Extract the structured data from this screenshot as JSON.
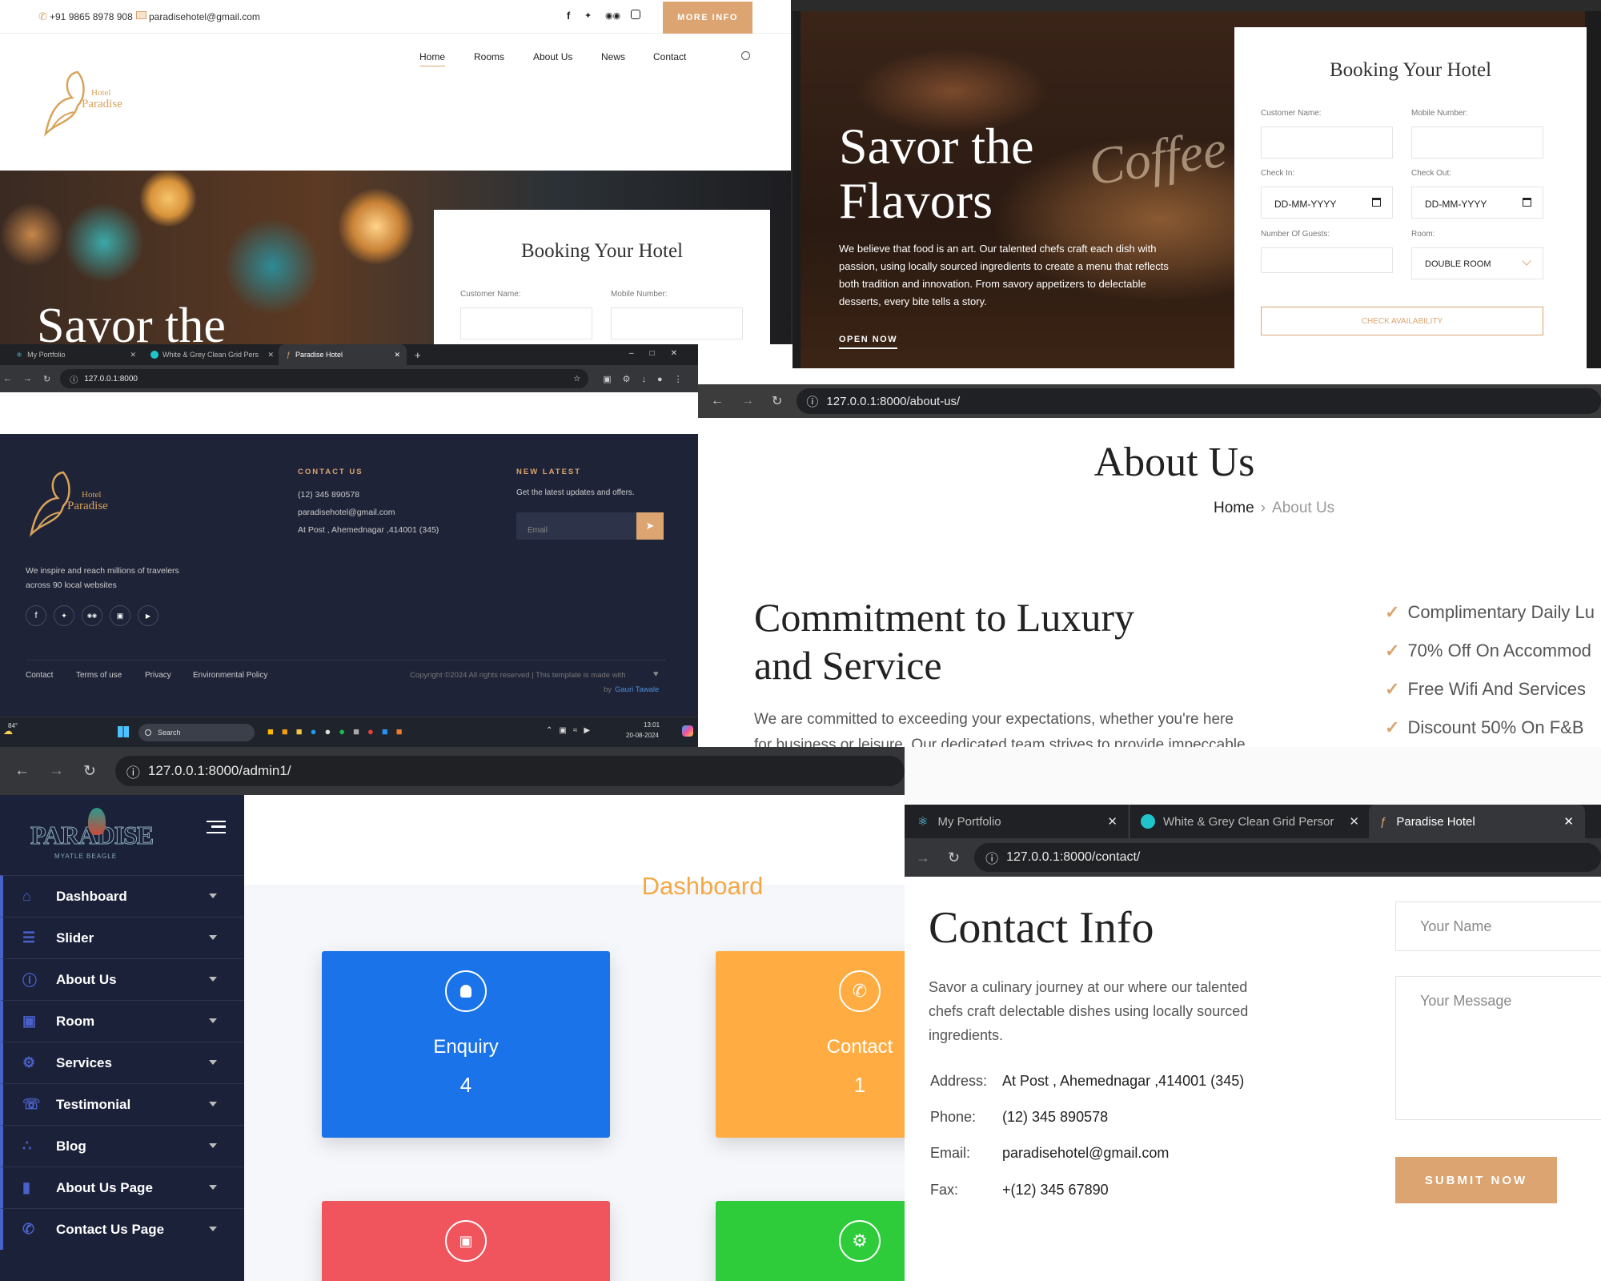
{
  "home": {
    "phone": "+91 9865 8978 908",
    "email": "paradisehotel@gmail.com",
    "more_info": "MORE INFO",
    "logo_top": "Hotel",
    "logo_main": "Paradise",
    "nav": [
      "Home",
      "Rooms",
      "About Us",
      "News",
      "Contact"
    ],
    "hero_partial": "Savor the",
    "booking_title": "Booking Your Hotel",
    "customer_label": "Customer Name:",
    "mobile_label": "Mobile Number:"
  },
  "hero": {
    "title_line1": "Savor the",
    "title_line2": "Flavors",
    "description": "We believe that food is an art. Our talented chefs craft each dish with passion, using locally sourced ingredients to create a menu that reflects both tradition and innovation. From savory appetizers to delectable desserts, every bite tells a story.",
    "cta": "OPEN NOW",
    "booking_title": "Booking Your Hotel",
    "customer_label": "Customer Name:",
    "mobile_label": "Mobile Number:",
    "checkin_label": "Check In:",
    "checkout_label": "Check Out:",
    "date_placeholder": "DD-MM-YYYY",
    "guests_label": "Number Of Guests:",
    "room_label": "Room:",
    "room_value": "DOUBLE ROOM",
    "check_button": "CHECK AVAILABILITY"
  },
  "footer_window": {
    "tabs": [
      "My Portfolio",
      "White & Grey Clean Grid Perso",
      "Paradise Hotel"
    ],
    "url": "127.0.0.1:8000",
    "logo_top": "Hotel",
    "logo_main": "Paradise",
    "tagline": "We inspire and reach millions of travelers across 90 local websites",
    "contact_heading": "CONTACT US",
    "contact_phone": "(12) 345 890578",
    "contact_email": "paradisehotel@gmail.com",
    "contact_address": "At Post , Ahemednagar ,414001 (345)",
    "newsletter_heading": "NEW LATEST",
    "newsletter_text": "Get the latest updates and offers.",
    "email_placeholder": "Email",
    "links": [
      "Contact",
      "Terms of use",
      "Privacy",
      "Environmental Policy"
    ],
    "copyright": "Copyright ©2024 All rights reserved | This template is made with",
    "by_text": "by",
    "author": "Gauri Tawale",
    "taskbar_temp": "84°",
    "taskbar_search": "Search",
    "time": "13:01",
    "date": "20-08-2024"
  },
  "about": {
    "url": "127.0.0.1:8000/about-us/",
    "title": "About Us",
    "breadcrumb_home": "Home",
    "breadcrumb_current": "About Us",
    "heading_line1": "Commitment to Luxury",
    "heading_line2": "and Service",
    "text_line1": "We are committed to exceeding your expectations, whether you're here",
    "text_line2": "for business or leisure. Our dedicated team strives to provide impeccable",
    "features": [
      "Complimentary Daily Lu",
      "70% Off On Accommod",
      "Free Wifi And Services",
      "Discount 50% On F&B"
    ]
  },
  "admin": {
    "url": "127.0.0.1:8000/admin1/",
    "logo_text": "PARADISE",
    "logo_sub": "MYATLE BEAGLE",
    "menu": [
      "Dashboard",
      "Slider",
      "About Us",
      "Room",
      "Services",
      "Testimonial",
      "Blog",
      "About Us Page",
      "Contact Us Page"
    ],
    "page_title": "Dashboard",
    "cards": [
      {
        "label": "Enquiry",
        "count": "4",
        "color": "#1a73e8"
      },
      {
        "label": "Contact",
        "count": "1",
        "color": "#ffad42"
      },
      {
        "label": "",
        "count": "",
        "color": "#f0545d"
      },
      {
        "label": "",
        "count": "",
        "color": "#2ecc3a"
      }
    ]
  },
  "contact": {
    "tabs": [
      "My Portfolio",
      "White & Grey Clean Grid Persor",
      "Paradise Hotel"
    ],
    "url": "127.0.0.1:8000/contact/",
    "title": "Contact Info",
    "intro_line1": "Savor a culinary journey at our where our talented",
    "intro_line2": "chefs craft delectable dishes using locally sourced",
    "intro_line3": "ingredients.",
    "address_label": "Address:",
    "address": "At Post , Ahemednagar ,414001 (345)",
    "phone_label": "Phone:",
    "phone": "(12) 345 890578",
    "email_label": "Email:",
    "email": "paradisehotel@gmail.com",
    "fax_label": "Fax:",
    "fax": "+(12) 345 67890",
    "name_placeholder": "Your Name",
    "message_placeholder": "Your Message",
    "submit": "SUBMIT NOW"
  },
  "colors": {
    "gold": "#dba470",
    "navy": "#1e2337",
    "sidebar": "#1b2138",
    "dashboard_title": "#f5a843"
  }
}
